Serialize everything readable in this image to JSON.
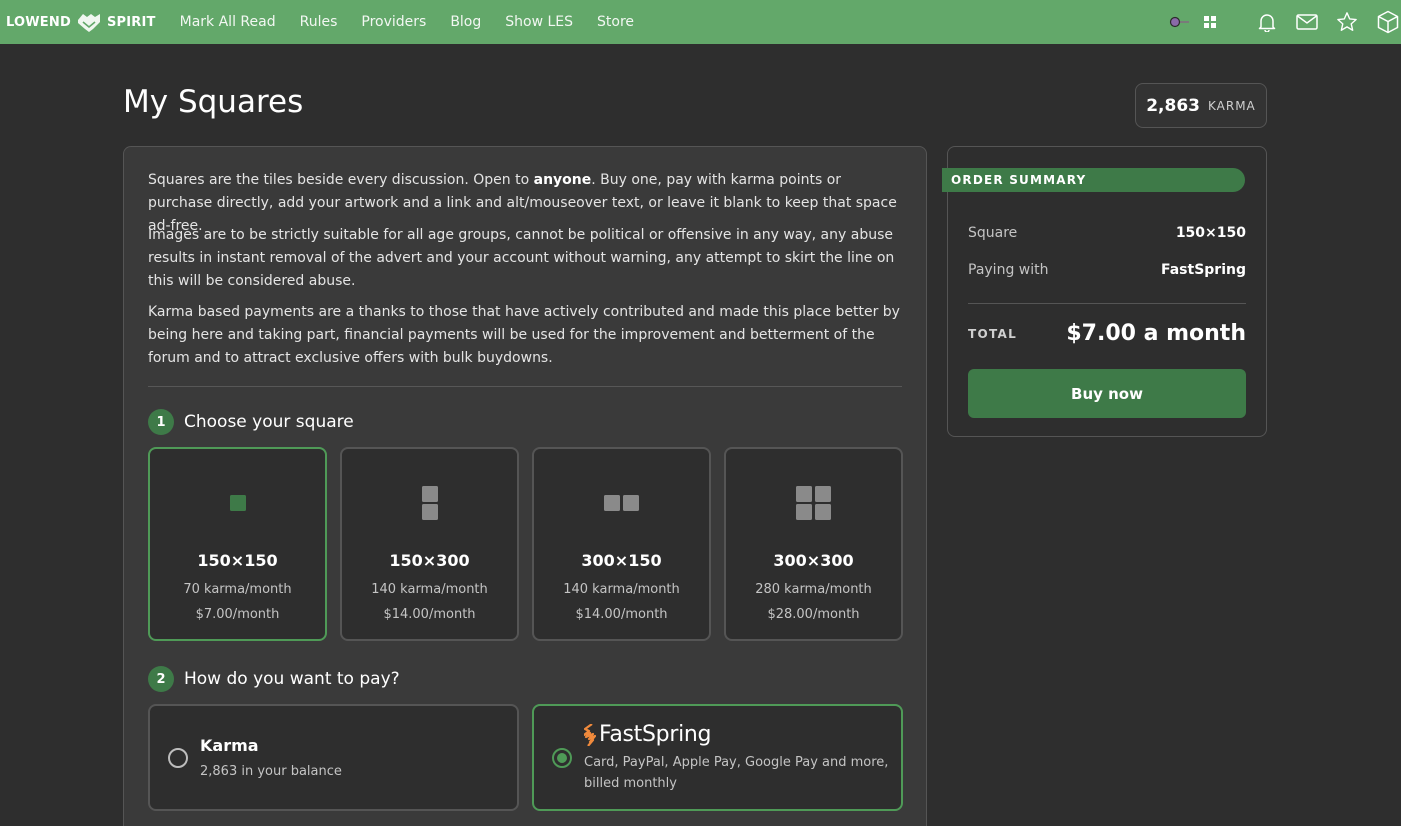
{
  "nav": {
    "logo_left": "LOWEND",
    "logo_right": "SPIRIT",
    "links": [
      "Mark All Read",
      "Rules",
      "Providers",
      "Blog",
      "Show LES",
      "Store"
    ]
  },
  "header": {
    "title": "My Squares",
    "karma_value": "2,863",
    "karma_label": "KARMA"
  },
  "intro": {
    "p1_before": "Squares are the tiles beside every discussion. Open to ",
    "p1_bold": "anyone",
    "p1_after": ". Buy one, pay with karma points or purchase directly, add your artwork and a link and alt/mouseover text, or leave it blank to keep that space ad-free.",
    "p2": "Images are to be strictly suitable for all age groups, cannot be political or offensive in any way, any abuse results in instant removal of the advert and your account without warning, any attempt to skirt the line on this will be considered abuse.",
    "p3": "Karma based payments are a thanks to those that have actively contributed and made this place better by being here and taking part, financial payments will be used for the improvement and betterment of the forum and to attract exclusive offers with bulk buydowns."
  },
  "step1": {
    "num": "1",
    "label": "Choose your square"
  },
  "squares": [
    {
      "size": "150×150",
      "karma": "70 karma/month",
      "price": "$7.00/month",
      "selected": true
    },
    {
      "size": "150×300",
      "karma": "140 karma/month",
      "price": "$14.00/month",
      "selected": false
    },
    {
      "size": "300×150",
      "karma": "140 karma/month",
      "price": "$14.00/month",
      "selected": false
    },
    {
      "size": "300×300",
      "karma": "280 karma/month",
      "price": "$28.00/month",
      "selected": false
    }
  ],
  "step2": {
    "num": "2",
    "label": "How do you want to pay?"
  },
  "payment": {
    "karma": {
      "title": "Karma",
      "sub": "2,863 in your balance",
      "selected": false
    },
    "fastspring": {
      "title": "FastSpring",
      "sub": "Card, PayPal, Apple Pay, Google Pay and more, billed monthly",
      "selected": true
    }
  },
  "summary": {
    "heading": "ORDER SUMMARY",
    "square_label": "Square",
    "square_value": "150×150",
    "paying_label": "Paying with",
    "paying_value": "FastSpring",
    "total_label": "TOTAL",
    "total_value": "$7.00 a month",
    "buy_label": "Buy now"
  },
  "colors": {
    "topbar": "#63a86a",
    "accent": "#3e7a48",
    "selected_border": "#4f9a57",
    "fastspring_orange": "#f08a3c"
  },
  "icons": [
    "theme-toggle-icon",
    "grid-icon",
    "bell-icon",
    "mail-icon",
    "star-icon",
    "cube-icon"
  ]
}
